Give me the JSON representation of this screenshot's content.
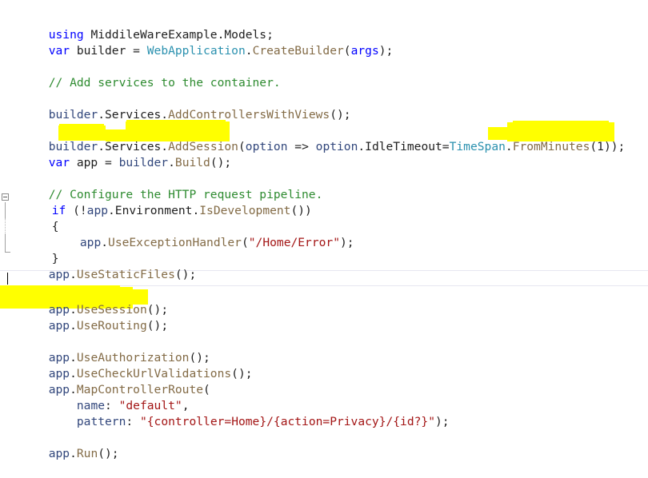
{
  "editor": {
    "language": "csharp",
    "file_kind": "Program.cs",
    "background_color": "#ffffff",
    "font_size_px": 14.6,
    "line_height_px": 20,
    "colors": {
      "keyword": "#0000ff",
      "comment": "#2e8b30",
      "type": "#2b91af",
      "method": "#836b46",
      "string": "#a31515",
      "identifier": "#32477c",
      "plain": "#1f1f1f",
      "marker_highlight": "#ffff00",
      "current_line_border": "#e6e6f0"
    }
  },
  "caret": {
    "line_index": 16,
    "column": 0,
    "visible": true
  },
  "current_line": {
    "line_index": 16
  },
  "outlining": {
    "collapse_toggle_line": 11,
    "region_start_line": 11,
    "region_end_line": 15,
    "expanded": true
  },
  "highlights": [
    {
      "id": "highlight-add-session",
      "label": "builder.Services.AddSession(opt",
      "color": "#ffff00",
      "line_index": 7
    },
    {
      "id": "highlight-from-minutes",
      "label": ".FromMinutes(1));",
      "color": "#ffff00",
      "line_index": 7
    },
    {
      "id": "highlight-use-session",
      "label": "app.UseSession();",
      "color": "#ffff00",
      "line_index": 17
    }
  ],
  "code": {
    "lines": [
      {
        "index": 0,
        "text": "using MiddileWareExample.Models;",
        "tokens": [
          {
            "text": "using",
            "kind": "keyword"
          },
          {
            "text": " MiddileWareExample.Models;",
            "kind": "plain"
          }
        ]
      },
      {
        "index": 1,
        "text": "var builder = WebApplication.CreateBuilder(args);",
        "tokens": [
          {
            "text": "var",
            "kind": "keyword"
          },
          {
            "text": " builder ",
            "kind": "plain"
          },
          {
            "text": "=",
            "kind": "plain"
          },
          {
            "text": " ",
            "kind": "plain"
          },
          {
            "text": "WebApplication",
            "kind": "type"
          },
          {
            "text": ".",
            "kind": "plain"
          },
          {
            "text": "CreateBuilder",
            "kind": "method"
          },
          {
            "text": "(",
            "kind": "plain"
          },
          {
            "text": "args",
            "kind": "keyword"
          },
          {
            "text": ");",
            "kind": "plain"
          }
        ]
      },
      {
        "index": 2,
        "text": "",
        "tokens": []
      },
      {
        "index": 3,
        "text": "// Add services to the container.",
        "tokens": [
          {
            "text": "// Add services to the container.",
            "kind": "comment"
          }
        ]
      },
      {
        "index": 4,
        "text": "",
        "tokens": []
      },
      {
        "index": 5,
        "text": "builder.Services.AddControllersWithViews();",
        "tokens": [
          {
            "text": "builder",
            "kind": "identifier"
          },
          {
            "text": ".Services.",
            "kind": "plain"
          },
          {
            "text": "AddControllersWithViews",
            "kind": "method"
          },
          {
            "text": "();",
            "kind": "plain"
          }
        ]
      },
      {
        "index": 6,
        "text": "",
        "tokens": []
      },
      {
        "index": 7,
        "text": "builder.Services.AddSession(option => option.IdleTimeout=TimeSpan.FromMinutes(1));",
        "tokens": [
          {
            "text": "builder",
            "kind": "identifier"
          },
          {
            "text": ".Services.",
            "kind": "plain"
          },
          {
            "text": "AddSession",
            "kind": "method"
          },
          {
            "text": "(",
            "kind": "plain"
          },
          {
            "text": "option",
            "kind": "identifier"
          },
          {
            "text": " => ",
            "kind": "plain"
          },
          {
            "text": "option",
            "kind": "identifier"
          },
          {
            "text": ".IdleTimeout=",
            "kind": "plain"
          },
          {
            "text": "TimeSpan",
            "kind": "type"
          },
          {
            "text": ".",
            "kind": "plain"
          },
          {
            "text": "FromMinutes",
            "kind": "method"
          },
          {
            "text": "(",
            "kind": "plain"
          },
          {
            "text": "1",
            "kind": "plain"
          },
          {
            "text": "));",
            "kind": "plain"
          }
        ]
      },
      {
        "index": 8,
        "text": "var app = builder.Build();",
        "tokens": [
          {
            "text": "var",
            "kind": "keyword"
          },
          {
            "text": " app ",
            "kind": "plain"
          },
          {
            "text": "= ",
            "kind": "plain"
          },
          {
            "text": "builder",
            "kind": "identifier"
          },
          {
            "text": ".",
            "kind": "plain"
          },
          {
            "text": "Build",
            "kind": "method"
          },
          {
            "text": "();",
            "kind": "plain"
          }
        ]
      },
      {
        "index": 9,
        "text": "",
        "tokens": []
      },
      {
        "index": 10,
        "text": "// Configure the HTTP request pipeline.",
        "tokens": [
          {
            "text": "// Configure the HTTP request pipeline.",
            "kind": "comment"
          }
        ]
      },
      {
        "index": 11,
        "text": "if (!app.Environment.IsDevelopment())",
        "tokens": [
          {
            "text": "if",
            "kind": "keyword"
          },
          {
            "text": " (!",
            "kind": "plain"
          },
          {
            "text": "app",
            "kind": "identifier"
          },
          {
            "text": ".Environment.",
            "kind": "plain"
          },
          {
            "text": "IsDevelopment",
            "kind": "method"
          },
          {
            "text": "())",
            "kind": "plain"
          }
        ]
      },
      {
        "index": 12,
        "text": "{",
        "tokens": [
          {
            "text": "{",
            "kind": "plain"
          }
        ]
      },
      {
        "index": 13,
        "text": "    app.UseExceptionHandler(\"/Home/Error\");",
        "tokens": [
          {
            "text": "    ",
            "kind": "plain"
          },
          {
            "text": "app",
            "kind": "identifier"
          },
          {
            "text": ".",
            "kind": "plain"
          },
          {
            "text": "UseExceptionHandler",
            "kind": "method"
          },
          {
            "text": "(",
            "kind": "plain"
          },
          {
            "text": "\"/Home/Error\"",
            "kind": "string"
          },
          {
            "text": ");",
            "kind": "plain"
          }
        ]
      },
      {
        "index": 14,
        "text": "}",
        "tokens": [
          {
            "text": "}",
            "kind": "plain"
          }
        ]
      },
      {
        "index": 15,
        "text": "app.UseStaticFiles();",
        "tokens": [
          {
            "text": "app",
            "kind": "identifier"
          },
          {
            "text": ".",
            "kind": "plain"
          },
          {
            "text": "UseStaticFiles",
            "kind": "method"
          },
          {
            "text": "();",
            "kind": "plain"
          }
        ]
      },
      {
        "index": 16,
        "text": "",
        "tokens": []
      },
      {
        "index": 17,
        "text": "app.UseSession();",
        "tokens": [
          {
            "text": "app",
            "kind": "identifier"
          },
          {
            "text": ".",
            "kind": "plain"
          },
          {
            "text": "UseSession",
            "kind": "method"
          },
          {
            "text": "();",
            "kind": "plain"
          }
        ]
      },
      {
        "index": 18,
        "text": "app.UseRouting();",
        "tokens": [
          {
            "text": "app",
            "kind": "identifier"
          },
          {
            "text": ".",
            "kind": "plain"
          },
          {
            "text": "UseRouting",
            "kind": "method"
          },
          {
            "text": "();",
            "kind": "plain"
          }
        ]
      },
      {
        "index": 19,
        "text": "",
        "tokens": []
      },
      {
        "index": 20,
        "text": "app.UseAuthorization();",
        "tokens": [
          {
            "text": "app",
            "kind": "identifier"
          },
          {
            "text": ".",
            "kind": "plain"
          },
          {
            "text": "UseAuthorization",
            "kind": "method"
          },
          {
            "text": "();",
            "kind": "plain"
          }
        ]
      },
      {
        "index": 21,
        "text": "app.UseCheckUrlValidations();",
        "tokens": [
          {
            "text": "app",
            "kind": "identifier"
          },
          {
            "text": ".",
            "kind": "plain"
          },
          {
            "text": "UseCheckUrlValidations",
            "kind": "method"
          },
          {
            "text": "();",
            "kind": "plain"
          }
        ]
      },
      {
        "index": 22,
        "text": "app.MapControllerRoute(",
        "tokens": [
          {
            "text": "app",
            "kind": "identifier"
          },
          {
            "text": ".",
            "kind": "plain"
          },
          {
            "text": "MapControllerRoute",
            "kind": "method"
          },
          {
            "text": "(",
            "kind": "plain"
          }
        ]
      },
      {
        "index": 23,
        "text": "    name: \"default\",",
        "tokens": [
          {
            "text": "    ",
            "kind": "plain"
          },
          {
            "text": "name",
            "kind": "identifier"
          },
          {
            "text": ": ",
            "kind": "plain"
          },
          {
            "text": "\"default\"",
            "kind": "string"
          },
          {
            "text": ",",
            "kind": "plain"
          }
        ]
      },
      {
        "index": 24,
        "text": "    pattern: \"{controller=Home}/{action=Privacy}/{id?}\");",
        "tokens": [
          {
            "text": "    ",
            "kind": "plain"
          },
          {
            "text": "pattern",
            "kind": "identifier"
          },
          {
            "text": ": ",
            "kind": "plain"
          },
          {
            "text": "\"{controller=Home}/{action=Privacy}/{id?}\"",
            "kind": "string"
          },
          {
            "text": ");",
            "kind": "plain"
          }
        ]
      },
      {
        "index": 25,
        "text": "",
        "tokens": []
      },
      {
        "index": 26,
        "text": "app.Run();",
        "tokens": [
          {
            "text": "app",
            "kind": "identifier"
          },
          {
            "text": ".",
            "kind": "plain"
          },
          {
            "text": "Run",
            "kind": "method"
          },
          {
            "text": "();",
            "kind": "plain"
          }
        ]
      }
    ]
  }
}
